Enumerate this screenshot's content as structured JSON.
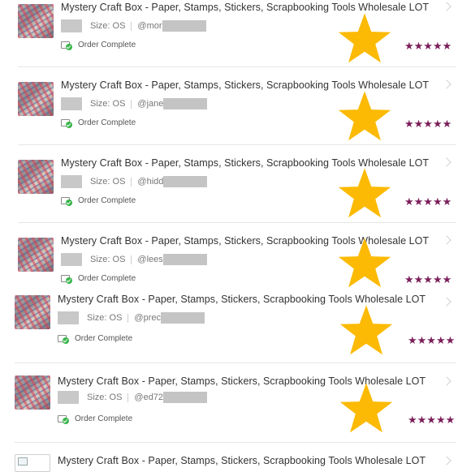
{
  "orders": [
    {
      "title": "Mystery Craft Box - Paper, Stamps, Stickers, Scrapbooking Tools Wholesale LOT",
      "size": "Size: OS",
      "user": "@mor",
      "status": "Order Complete",
      "rating": "★★★★★"
    },
    {
      "title": "Mystery Craft Box - Paper, Stamps, Stickers, Scrapbooking Tools Wholesale LOT",
      "size": "Size: OS",
      "user": "@jane",
      "status": "Order Complete",
      "rating": "★★★★★"
    },
    {
      "title": "Mystery Craft Box - Paper, Stamps, Stickers, Scrapbooking Tools Wholesale LOT",
      "size": "Size: OS",
      "user": "@hidd",
      "status": "Order Complete",
      "rating": "★★★★★"
    },
    {
      "title": "Mystery Craft Box - Paper, Stamps, Stickers, Scrapbooking Tools Wholesale LOT",
      "size": "Size: OS",
      "user": "@lees",
      "status": "Order Complete",
      "rating": "★★★★★"
    },
    {
      "title": "Mystery Craft Box - Paper, Stamps, Stickers, Scrapbooking Tools Wholesale LOT",
      "size": "Size: OS",
      "user": "@prec",
      "status": "Order Complete",
      "rating": "★★★★★"
    },
    {
      "title": "Mystery Craft Box - Paper, Stamps, Stickers, Scrapbooking Tools Wholesale LOT",
      "size": "Size: OS",
      "user": "@ed72",
      "status": "Order Complete",
      "rating": "★★★★★"
    },
    {
      "title": "Mystery Craft Box - Paper, Stamps, Stickers, Scrapbooking Tools Wholesale LOT"
    }
  ],
  "colors": {
    "star_overlay": "#fcba04",
    "rating_stars": "#7b1f5a",
    "check": "#38b54a"
  },
  "icons": {
    "status": "order-complete-icon",
    "overlay": "big-star-icon",
    "nav": "chevron-right-icon"
  }
}
